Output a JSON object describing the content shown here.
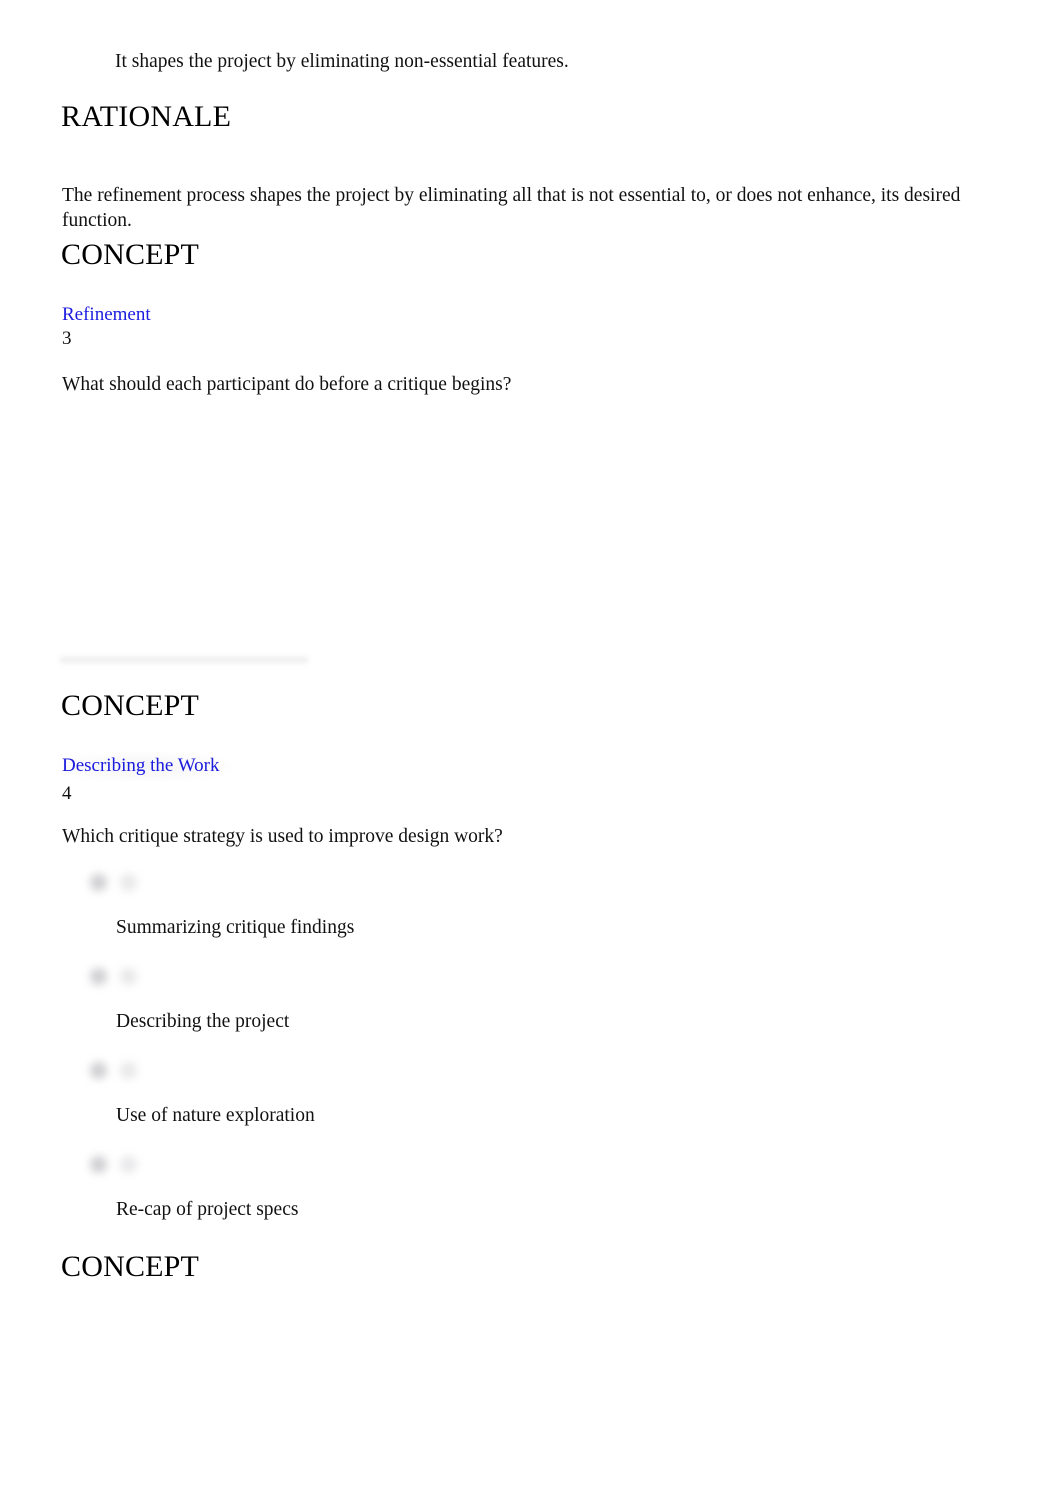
{
  "document": {
    "answer_statement": "It shapes the project by eliminating non-essential features.",
    "rationale": {
      "heading": "RATIONALE",
      "body": "The refinement process shapes the project by eliminating all that is not essential to, or does not enhance, its desired function."
    },
    "concepts": [
      {
        "heading": "CONCEPT",
        "link_label": "Refinement",
        "number": "3",
        "question": "What should each participant do before a critique begins?",
        "options": []
      },
      {
        "heading": "CONCEPT",
        "link_label": "Describing the Work",
        "number": "4",
        "question": "Which critique strategy is used to improve design work?",
        "options": [
          "Summarizing critique findings",
          "Describing the project",
          "Use of nature exploration",
          "Re-cap of project specs"
        ]
      },
      {
        "heading": "CONCEPT"
      }
    ]
  },
  "colors": {
    "page_background": "#ffffff",
    "body_text": "#111111",
    "heading_text": "#000000",
    "link": "#1c1ce0",
    "divider": "#78788022"
  }
}
